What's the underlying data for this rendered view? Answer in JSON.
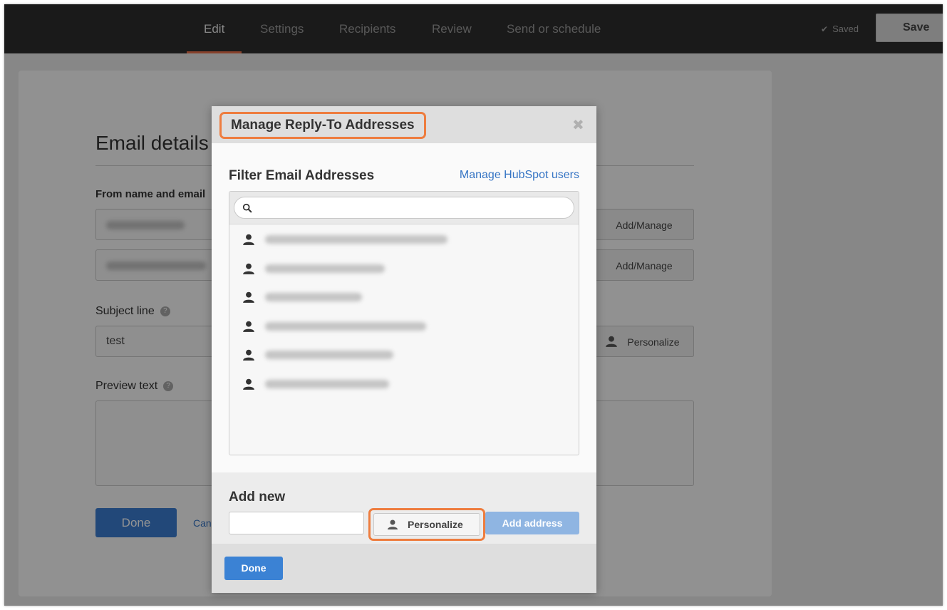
{
  "nav": {
    "tabs": [
      {
        "label": "Edit"
      },
      {
        "label": "Settings"
      },
      {
        "label": "Recipients"
      },
      {
        "label": "Review"
      },
      {
        "label": "Send or schedule"
      }
    ],
    "saved_label": "Saved",
    "save_label": "Save"
  },
  "background": {
    "title": "Email details",
    "from_label": "From name and email",
    "add_manage_label": "Add/Manage",
    "subject_label": "Subject line",
    "subject_value": "test",
    "personalize_label": "Personalize",
    "preview_label": "Preview text",
    "done_label": "Done",
    "cancel_label": "Can"
  },
  "modal": {
    "title": "Manage Reply-To Addresses",
    "filter_title": "Filter Email Addresses",
    "manage_link": "Manage HubSpot users",
    "search_placeholder": "",
    "addresses_blurred_count_note": "",
    "add_new_title": "Add new",
    "add_new_placeholder": "",
    "personalize_label": "Personalize",
    "add_address_label": "Add address",
    "done_label": "Done"
  },
  "colors": {
    "accent_orange": "#ee7d3f",
    "nav_bg": "#2d2d2d",
    "primary_blue": "#3b82d4",
    "link_blue": "#3574c4"
  },
  "icons": {
    "saved": "check-icon",
    "close": "close-icon",
    "search": "search-icon",
    "person": "person-icon",
    "help": "question-icon"
  }
}
